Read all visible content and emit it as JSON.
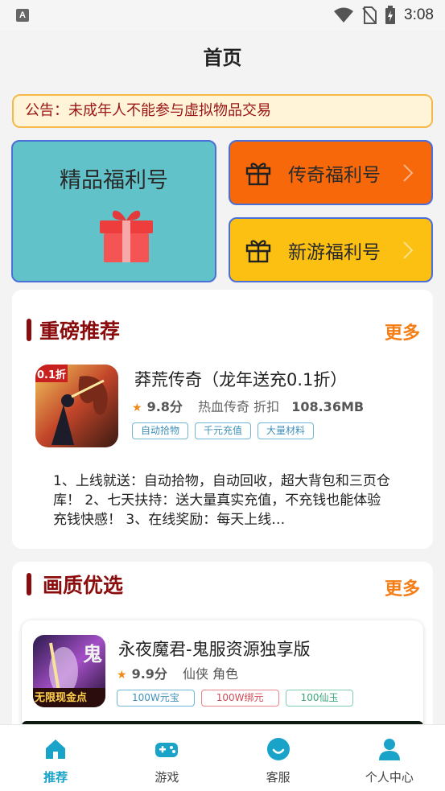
{
  "status_bar": {
    "time": "3:08",
    "app_badge": "A"
  },
  "page_title": "首页",
  "notice": {
    "text": "公告：未成年人不能参与虚拟物品交易"
  },
  "welfare": {
    "big_tile": {
      "label": "精品福利号",
      "color": "#62c2c9"
    },
    "legend_tile": {
      "label": "传奇福利号",
      "color": "#f7680b"
    },
    "new_tile": {
      "label": "新游福利号",
      "color": "#fcc012"
    }
  },
  "featured": {
    "title": "重磅推荐",
    "more": "更多",
    "game": {
      "icon_badge": "0.1折",
      "name": "莽荒传奇（龙年送充0.1折）",
      "rating": "9.8分",
      "meta": "热血传奇 折扣",
      "size": "108.36MB",
      "tags": [
        "自动拾物",
        "千元充值",
        "大量材料"
      ],
      "description": "1、上线就送：自动拾物，自动回收，超大背包和三页仓库！ 2、七天扶持：送大量真实充值，不充钱也能体验充钱快感！ 3、在线奖励：每天上线…"
    }
  },
  "quality": {
    "title": "画质优选",
    "more": "更多",
    "game": {
      "icon_text": "无限现金点",
      "icon_char": "鬼",
      "name": "永夜魔君-鬼服资源独享版",
      "rating": "9.9分",
      "meta": "仙侠 角色",
      "tags": [
        "100W元宝",
        "100W绑元",
        "100仙玉"
      ]
    }
  },
  "bottom_nav": [
    {
      "label": "推荐",
      "icon": "home-icon",
      "active": true
    },
    {
      "label": "游戏",
      "icon": "gamepad-icon",
      "active": false
    },
    {
      "label": "客服",
      "icon": "customer-service-icon",
      "active": false
    },
    {
      "label": "个人中心",
      "icon": "person-icon",
      "active": false
    }
  ],
  "colors": {
    "accent": "#1aa3c8",
    "section_title": "#8b0c0c",
    "more": "#f57d14"
  }
}
